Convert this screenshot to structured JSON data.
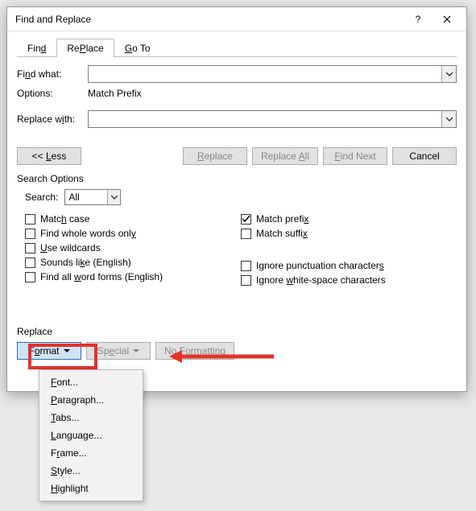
{
  "dialog": {
    "title": "Find and Replace",
    "tabs": {
      "find": "Find",
      "find_accel": "d",
      "replace": "Replace",
      "replace_accel": "P",
      "goto": "Go To",
      "goto_accel": "G"
    },
    "find_what_label_pre": "Fi",
    "find_what_label_ul": "n",
    "find_what_label_post": "d what:",
    "find_what_value": "",
    "options_label": "Options:",
    "options_value": "Match Prefix",
    "replace_with_label_pre": "Replace w",
    "replace_with_label_ul": "i",
    "replace_with_label_post": "th:",
    "replace_with_value": "",
    "buttons": {
      "less_pre": "<< ",
      "less_ul": "L",
      "less_post": "ess",
      "replace_ul": "R",
      "replace_post": "eplace",
      "replace_all_pre": "Replace ",
      "replace_all_ul": "A",
      "replace_all_post": "ll",
      "find_next_ul": "F",
      "find_next_post": "ind Next",
      "cancel": "Cancel"
    },
    "search_options_label": "Search Options",
    "search_label_pre": "Searc",
    "search_label_ul": "h",
    "search_label_post": ":",
    "search_value": "All",
    "checkboxes": {
      "match_case_pre": "Matc",
      "match_case_ul": "h",
      "match_case_post": " case",
      "whole_words_pre": "Find whole words onl",
      "whole_words_ul": "y",
      "wildcards_ul": "U",
      "wildcards_post": "se wildcards",
      "sounds_like_pre": "Sounds li",
      "sounds_like_ul": "k",
      "sounds_like_post": "e (English)",
      "word_forms_pre": "Find all ",
      "word_forms_ul": "w",
      "word_forms_post": "ord forms (English)",
      "match_prefix_pre": "Match prefi",
      "match_prefix_ul": "x",
      "match_suffix_pre": "Match suffi",
      "match_suffix_ul": "x",
      "ignore_punct_pre": "Ignore punctuation character",
      "ignore_punct_ul": "s",
      "ignore_ws_pre": "Ignore ",
      "ignore_ws_ul": "w",
      "ignore_ws_post": "hite-space characters"
    },
    "replace_section_label": "Replace",
    "bottom": {
      "format_pre": "F",
      "format_ul": "o",
      "format_post": "rmat",
      "special_pre": "Sp",
      "special_ul": "e",
      "special_post": "cial",
      "noformat_pre": "No Forma",
      "noformat_ul": "t",
      "noformat_post": "ting"
    }
  },
  "menu": {
    "font_ul": "F",
    "font_post": "ont...",
    "paragraph_ul": "P",
    "paragraph_post": "aragraph...",
    "tabs_ul": "T",
    "tabs_post": "abs...",
    "language_ul": "L",
    "language_post": "anguage...",
    "frame_pre": "F",
    "frame_ul": "r",
    "frame_post": "ame...",
    "style_ul": "S",
    "style_post": "tyle...",
    "highlight_ul": "H",
    "highlight_post": "ighlight"
  }
}
